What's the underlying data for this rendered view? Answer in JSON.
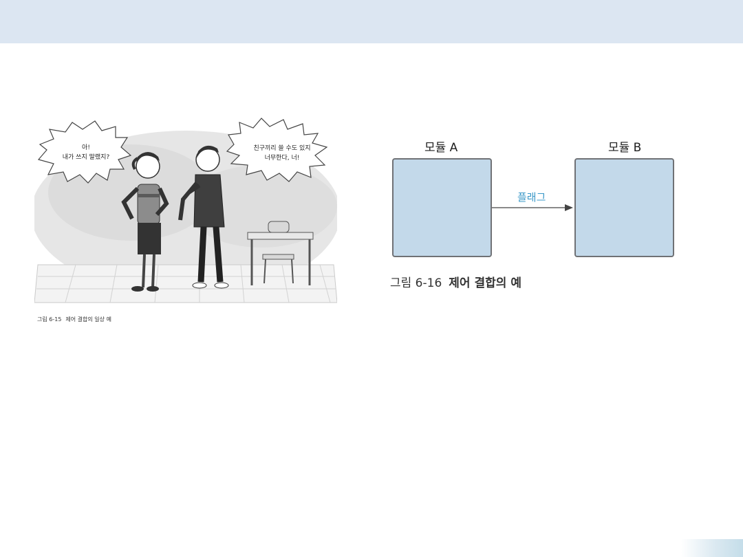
{
  "colors": {
    "header_band": "#dce6f2",
    "module_fill": "#c3d9ea",
    "module_border": "#6f7175",
    "flag_label": "#3a98c8"
  },
  "illustration": {
    "bubble_left": {
      "line1": "아!",
      "line2": "내가 쓰지 말랬지?"
    },
    "bubble_right": {
      "line1": "친구끼리 쓸 수도 있지",
      "line2": "너무한다, 너!"
    },
    "caption_number": "그림 6-15",
    "caption_title": "제어 결합의 일상 예"
  },
  "diagram": {
    "module_a": "모듈 A",
    "module_b": "모듈 B",
    "flag": "플래그",
    "caption_number": "그림 6-16",
    "caption_title": "제어 결합의 예"
  }
}
